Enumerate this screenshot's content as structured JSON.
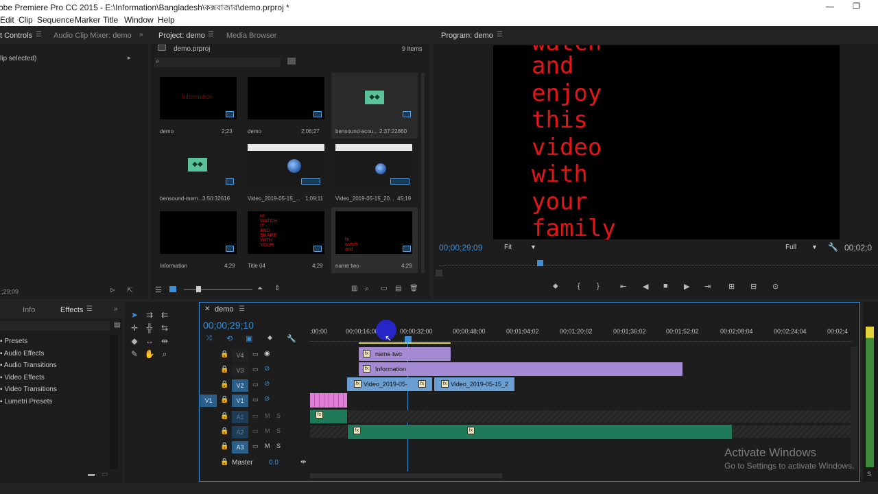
{
  "window": {
    "title": "obe Premiere Pro CC 2015 - E:\\Information\\Bangladesh\\কক্সবাজার\\demo.prproj *",
    "minimize": "—",
    "restore": "❐"
  },
  "menu": [
    "Edit",
    "Clip",
    "Sequence",
    "Marker",
    "Title",
    "Window",
    "Help"
  ],
  "effect_controls": {
    "tab": "t Controls",
    "tab2": "Audio Clip Mixer: demo",
    "status": "lip selected)",
    "timecode": ";29;09"
  },
  "project": {
    "tab": "Project: demo",
    "tab2": "Media Browser",
    "filename": "demo.prproj",
    "count": "9 Items",
    "items": [
      {
        "name": "demo",
        "duration": "2;23"
      },
      {
        "name": "demo",
        "duration": "2;06;27"
      },
      {
        "name": "bensound-acou...",
        "duration": "2:37:22860"
      },
      {
        "name": "bensound-mem...",
        "duration": "3:50:32616"
      },
      {
        "name": "Video_2019-05-15_...",
        "duration": "1;09;11"
      },
      {
        "name": "Video_2019-05-15_20...",
        "duration": "45;19"
      },
      {
        "name": "Information",
        "duration": "4;29"
      },
      {
        "name": "Title 04",
        "duration": "4;29"
      },
      {
        "name": "name two",
        "duration": "4;29"
      }
    ],
    "thumb_texts": {
      "t1": "Information",
      "t8": "HI\nWATCH\nIT\nAND\nSHARE\nWITH\nYOUR",
      "t9": "hi\nwatch\nand"
    }
  },
  "program": {
    "tab": "Program: demo",
    "lines": [
      "watch",
      "and",
      "enjoy",
      "this",
      "video",
      "with",
      "your",
      "family"
    ],
    "timecode": "00;00;29;09",
    "fit": "Fit",
    "full": "Full",
    "duration": "00;02;0"
  },
  "effects_panel": {
    "tab_info": "Info",
    "tab_effects": "Effects",
    "items": [
      "Presets",
      "Audio Effects",
      "Audio Transitions",
      "Video Effects",
      "Video Transitions",
      "Lumetri Presets"
    ]
  },
  "timeline": {
    "tab": "demo",
    "timecode": "00;00;29;10",
    "ruler": [
      ";00;00",
      "00;00;16;00",
      "00;00;32;00",
      "00;00;48;00",
      "00;01;04;02",
      "00;01;20;02",
      "00;01;36;02",
      "00;01;52;02",
      "00;02;08;04",
      "00;02;24;04",
      "00;02;4"
    ],
    "tracks": {
      "v4": "V4",
      "v3": "V3",
      "v2": "V2",
      "v1": "V1",
      "v1src": "V1",
      "a1": "A1",
      "a2": "A2",
      "a3": "A3",
      "master": "Master",
      "master_val": "0.0"
    },
    "m": "M",
    "s": "S",
    "clips": {
      "name_two": "name two",
      "information": "Information",
      "video1": "Video_2019-05-",
      "video2": "Video_2019-05-15_2"
    }
  },
  "watermark": {
    "line1": "Activate Windows",
    "line2": "Go to Settings to activate Windows."
  },
  "colors": {
    "clip_purple": "#a58bd4",
    "clip_blue": "#6a9fd4",
    "clip_pink": "#e07ed8",
    "clip_green": "#1f7a5a",
    "accent_blue": "#3a8fd8"
  }
}
